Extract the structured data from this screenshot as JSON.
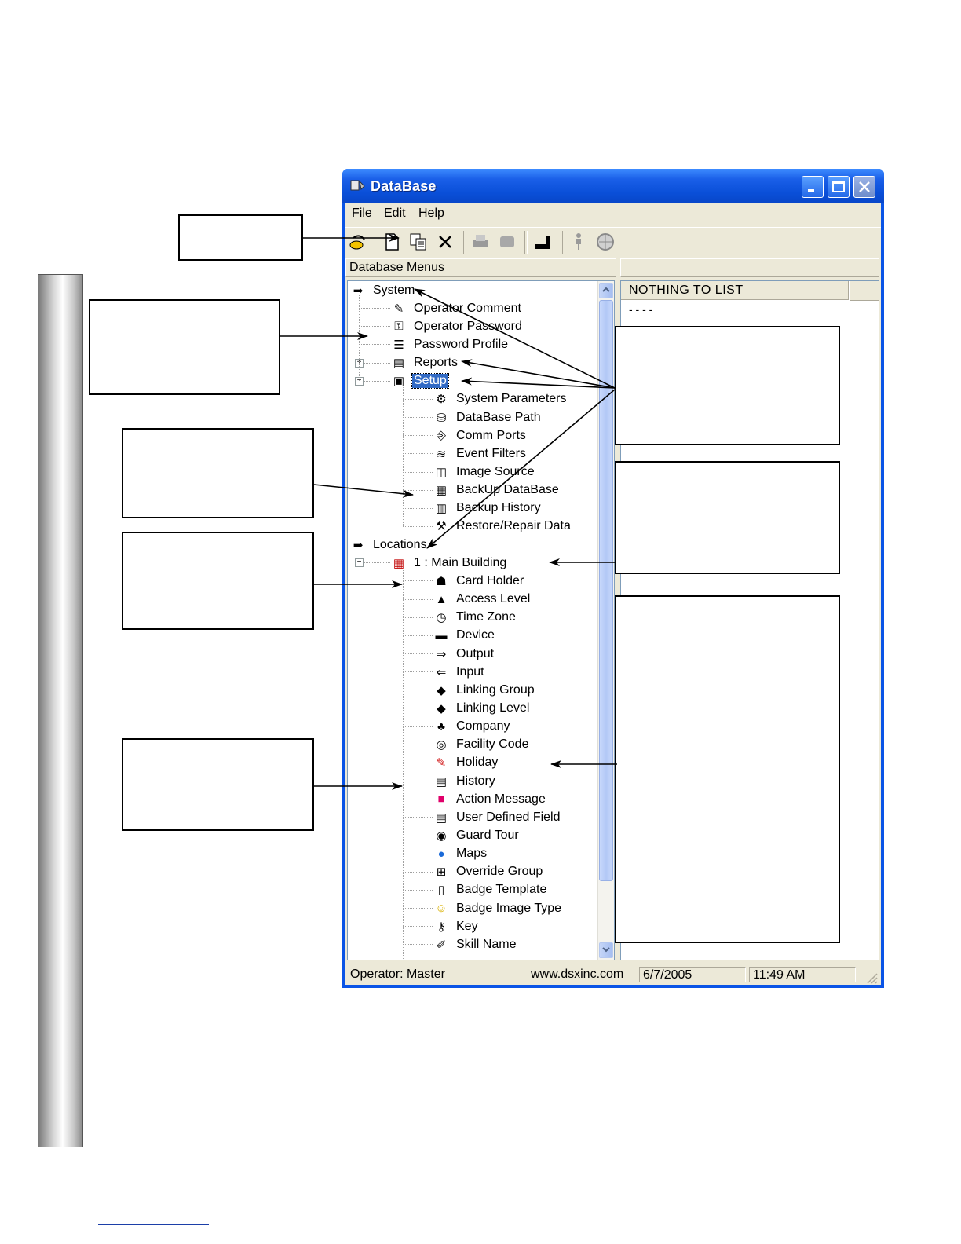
{
  "window": {
    "title": "DataBase",
    "menu": [
      "File",
      "Edit",
      "Help"
    ],
    "left_panel_label": "Database Menus",
    "list_header": "NOTHING TO LIST",
    "list_row": "- - - -"
  },
  "tree": {
    "system": "System",
    "system_items": [
      "Operator Comment",
      "Operator Password",
      "Password Profile",
      "Reports",
      "Setup"
    ],
    "setup_items": [
      "System Parameters",
      "DataBase Path",
      "Comm Ports",
      "Event Filters",
      "Image Source",
      "BackUp DataBase",
      "Backup History",
      "Restore/Repair Data"
    ],
    "locations": "Locations",
    "location": "1 : Main Building",
    "location_items": [
      "Card Holder",
      "Access Level",
      "Time Zone",
      "Device",
      "Output",
      "Input",
      "Linking Group",
      "Linking Level",
      "Company",
      "Facility Code",
      "Holiday",
      "History",
      "Action Message",
      "User Defined Field",
      "Guard Tour",
      "Maps",
      "Override Group",
      "Badge Template",
      "Badge Image Type",
      "Key",
      "Skill Name"
    ]
  },
  "status": {
    "operator": "Operator:  Master",
    "website": "www.dsxinc.com",
    "date": "6/7/2005",
    "time": "11:49 AM"
  },
  "colors": {
    "titlebar": "#0a54e6",
    "selection": "#316ac5",
    "window_face": "#ece9d8"
  }
}
